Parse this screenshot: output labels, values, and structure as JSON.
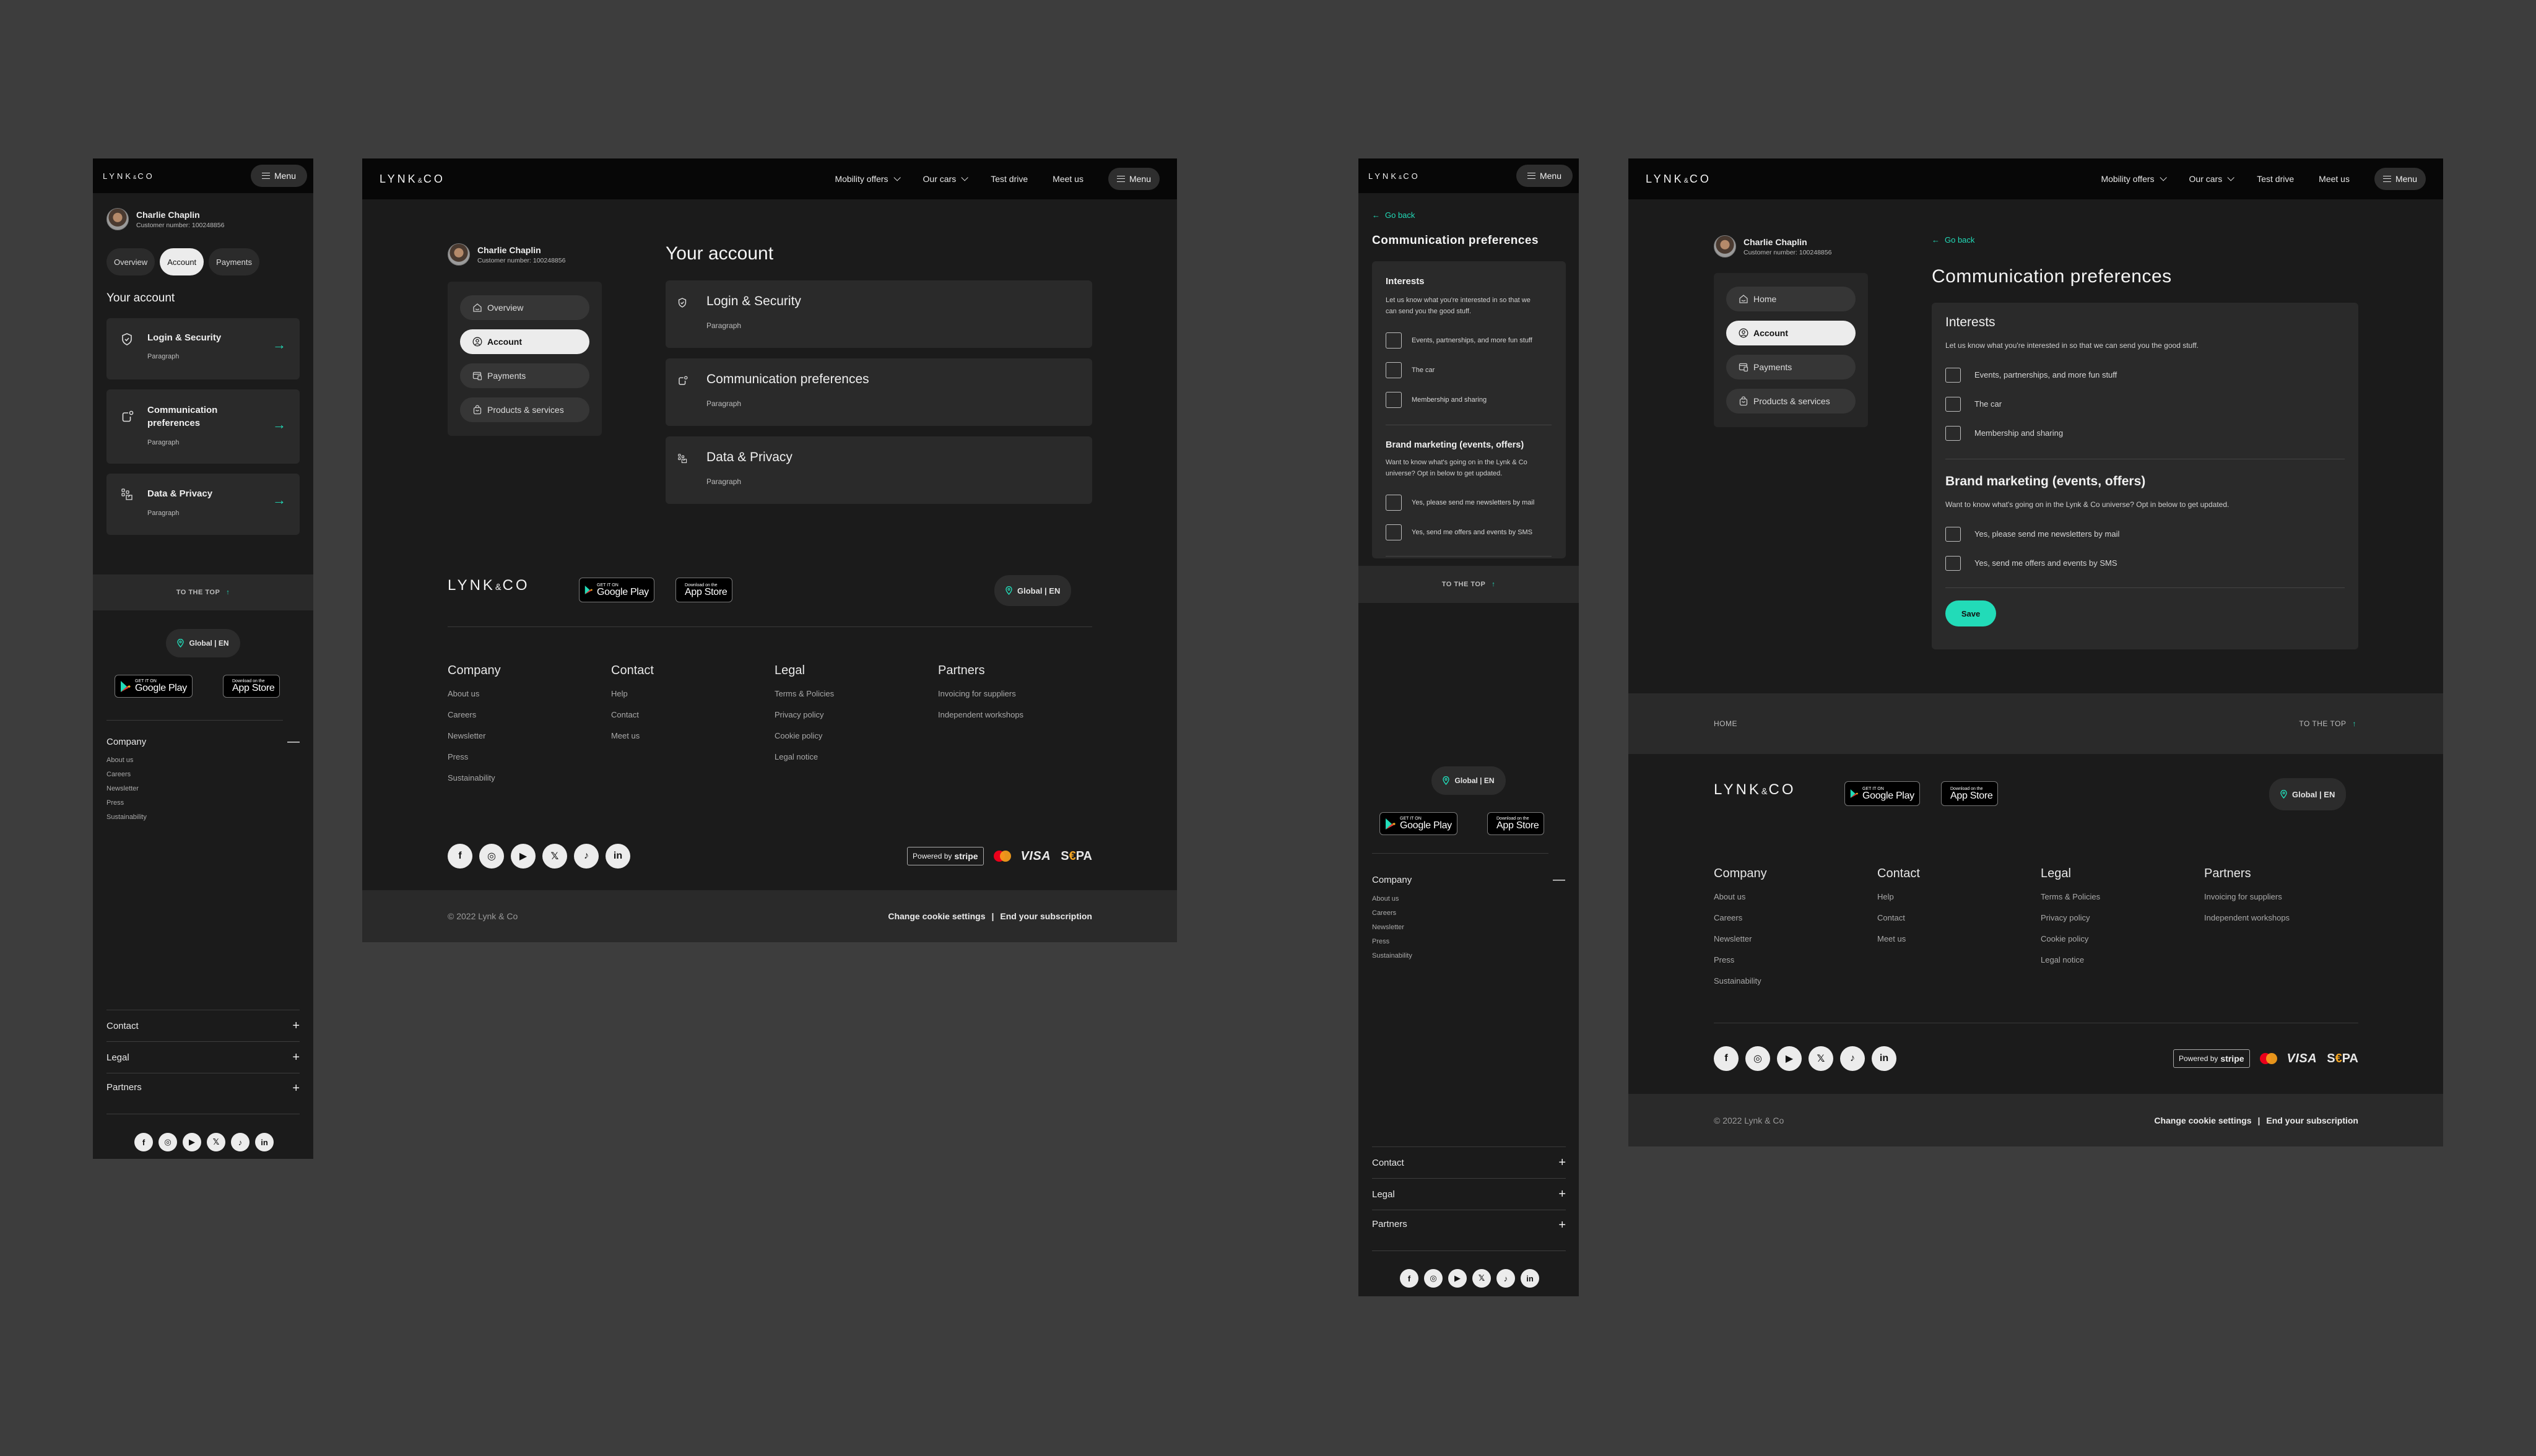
{
  "brand": {
    "logo_main": "LYNK",
    "logo_amp": "&",
    "logo_end": "CO",
    "accent": "#22DBB8",
    "bg": "#1B1B1B",
    "card": "#2A2A2A"
  },
  "header": {
    "nav": [
      {
        "label": "Mobility offers",
        "dropdown": true
      },
      {
        "label": "Our cars",
        "dropdown": true
      },
      {
        "label": "Test drive",
        "dropdown": false
      },
      {
        "label": "Meet us",
        "dropdown": false
      }
    ],
    "menu_label": "Menu"
  },
  "profile": {
    "name": "Charlie Chaplin",
    "customer_number": "Customer number: 100248856"
  },
  "mobile_tabs": [
    {
      "label": "Overview",
      "active": false
    },
    {
      "label": "Account",
      "active": true
    },
    {
      "label": "Payments",
      "active": false
    }
  ],
  "sidenav_account": [
    {
      "label": "Overview",
      "icon": "home-icon",
      "active": false
    },
    {
      "label": "Account",
      "icon": "user-circle-icon",
      "active": true
    },
    {
      "label": "Payments",
      "icon": "wallet-icon",
      "active": false
    },
    {
      "label": "Products & services",
      "icon": "shopping-bag-icon",
      "active": false
    }
  ],
  "sidenav_comm": [
    {
      "label": "Home",
      "icon": "home-icon",
      "active": false
    },
    {
      "label": "Account",
      "icon": "user-circle-icon",
      "active": true
    },
    {
      "label": "Payments",
      "icon": "wallet-icon",
      "active": false
    },
    {
      "label": "Products & services",
      "icon": "shopping-bag-icon",
      "active": false
    }
  ],
  "account": {
    "title": "Your account",
    "cards": [
      {
        "title": "Login & Security",
        "title_mobile": "Login & Security",
        "paragraph": "Paragraph",
        "icon": "shield-check-icon"
      },
      {
        "title": "Communication preferences",
        "title_mobile": "Communication preferences",
        "paragraph": "Paragraph",
        "icon": "notification-icon"
      },
      {
        "title": "Data & Privacy",
        "title_mobile": "Data & Privacy",
        "paragraph": "Paragraph",
        "icon": "data-privacy-icon"
      }
    ]
  },
  "comm": {
    "go_back": "Go back",
    "title": "Communication preferences",
    "interests": {
      "heading": "Interests",
      "desc": "Let us know what you're interested in so that we can send you the good stuff.",
      "options": [
        {
          "label": "Events, partnerships, and more fun stuff",
          "checked": false
        },
        {
          "label": "The car",
          "checked": false
        },
        {
          "label": "Membership and sharing",
          "checked": false
        }
      ]
    },
    "marketing": {
      "heading": "Brand marketing (events, offers)",
      "desc": "Want to know what's going on in the Lynk & Co universe? Opt in below to get updated.",
      "options": [
        {
          "label": "Yes, please send me newsletters by mail",
          "checked": false
        },
        {
          "label": "Yes, send me offers and events by SMS",
          "checked": false
        }
      ]
    },
    "save_label": "Save"
  },
  "to_top": {
    "label": "TO THE TOP",
    "breadcrumb_home": "HOME"
  },
  "footer": {
    "region": "Global | EN",
    "google_play": {
      "small": "GET IT ON",
      "big": "Google Play"
    },
    "app_store": {
      "small": "Download on the",
      "big": "App Store"
    },
    "columns": [
      {
        "title": "Company",
        "links": [
          "About us",
          "Careers",
          "Newsletter",
          "Press",
          "Sustainability"
        ],
        "expanded_mobile": true
      },
      {
        "title": "Contact",
        "links": [
          "Help",
          "Contact",
          "Meet us"
        ],
        "expanded_mobile": false
      },
      {
        "title": "Legal",
        "links": [
          "Terms & Policies",
          "Privacy policy",
          "Cookie policy",
          "Legal notice"
        ],
        "expanded_mobile": false
      },
      {
        "title": "Partners",
        "links": [
          "Invoicing for suppliers",
          "Independent workshops"
        ],
        "expanded_mobile": false
      }
    ],
    "socials": [
      {
        "name": "facebook",
        "glyph": "f"
      },
      {
        "name": "instagram",
        "glyph": "◎"
      },
      {
        "name": "youtube",
        "glyph": "▶"
      },
      {
        "name": "x",
        "glyph": "𝕏"
      },
      {
        "name": "tiktok",
        "glyph": "♪"
      },
      {
        "name": "linkedin",
        "glyph": "in"
      }
    ],
    "stripe": {
      "powered": "Powered by",
      "brand": "stripe"
    },
    "payments": {
      "visa": "VISA",
      "sepa_s": "S",
      "sepa_eur": "€",
      "sepa_pa": "PA"
    },
    "cookie_settings": "Change cookie settings",
    "separator": "|",
    "end_subscription": "End your subscription",
    "copyright": "© 2022 Lynk & Co"
  }
}
